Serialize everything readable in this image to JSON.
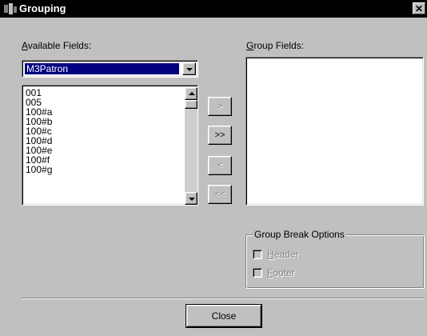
{
  "window": {
    "title": "Grouping",
    "close_glyph": "✕"
  },
  "available_fields": {
    "label_prefix": "",
    "label_accel": "A",
    "label_rest": "vailable Fields:",
    "dropdown_value": "M3Patron",
    "items": [
      "001",
      "005",
      "100#a",
      "100#b",
      "100#c",
      "100#d",
      "100#e",
      "100#f",
      "100#g"
    ]
  },
  "group_fields": {
    "label_accel": "G",
    "label_rest": "roup Fields:",
    "items": []
  },
  "buttons": {
    "add": ">",
    "add_all": ">>",
    "remove": "<",
    "remove_all": "<<",
    "close": "Close"
  },
  "group_break_options": {
    "legend": "Group Break Options",
    "header_accel": "H",
    "header_rest": "eader",
    "footer_accel": "F",
    "footer_rest": "ooter",
    "header_checked": false,
    "footer_checked": false
  }
}
